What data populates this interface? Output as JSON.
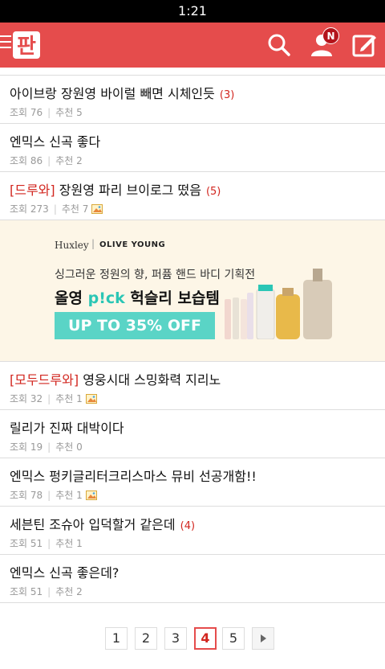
{
  "status_bar": {
    "time": "1:21"
  },
  "app_bar": {
    "logo_text": "판",
    "notification_badge": "N",
    "accent": "#e54c4c"
  },
  "posts_top": [
    {
      "tag": "",
      "title": "아이브랑 장원영 바이럴 빼면 시체인듯",
      "comments": "(3)",
      "views_label": "조회 76",
      "likes_label": "추천 5",
      "has_image": false
    },
    {
      "tag": "",
      "title": "엔믹스 신곡 좋다",
      "comments": "",
      "views_label": "조회 86",
      "likes_label": "추천 2",
      "has_image": false
    },
    {
      "tag": "[드루와]",
      "title": "장원영 파리 브이로그 떴음",
      "comments": "(5)",
      "views_label": "조회 273",
      "likes_label": "추천 7",
      "has_image": true
    }
  ],
  "ad": {
    "brand": "Huxley",
    "partner": "OLIVE YOUNG",
    "subtitle": "싱그러운 정원의 향, 퍼퓸 핸드 바디 기획전",
    "headline_prefix": "올영",
    "headline_pick": "p!ck",
    "headline_suffix": "헉슬리 보습템",
    "discount": "UP TO 35% OFF"
  },
  "posts_bottom": [
    {
      "tag": "[모두드루와]",
      "title": "영웅시대 스밍화력 지리노",
      "comments": "",
      "views_label": "조회 32",
      "likes_label": "추천 1",
      "has_image": true
    },
    {
      "tag": "",
      "title": "릴리가 진짜 대박이다",
      "comments": "",
      "views_label": "조회 19",
      "likes_label": "추천 0",
      "has_image": false
    },
    {
      "tag": "",
      "title": "엔믹스 펑키글리터크리스마스 뮤비 선공개함!!",
      "comments": "",
      "views_label": "조회 78",
      "likes_label": "추천 1",
      "has_image": true
    },
    {
      "tag": "",
      "title": "세븐틴 조슈아 입덕할거 같은데",
      "comments": "(4)",
      "views_label": "조회 51",
      "likes_label": "추천 1",
      "has_image": false
    },
    {
      "tag": "",
      "title": "엔믹스 신곡 좋은데?",
      "comments": "",
      "views_label": "조회 51",
      "likes_label": "추천 2",
      "has_image": false
    }
  ],
  "pagination": {
    "pages": [
      "1",
      "2",
      "3",
      "4",
      "5"
    ],
    "current": "4",
    "next_icon": "triangle-right-icon"
  }
}
